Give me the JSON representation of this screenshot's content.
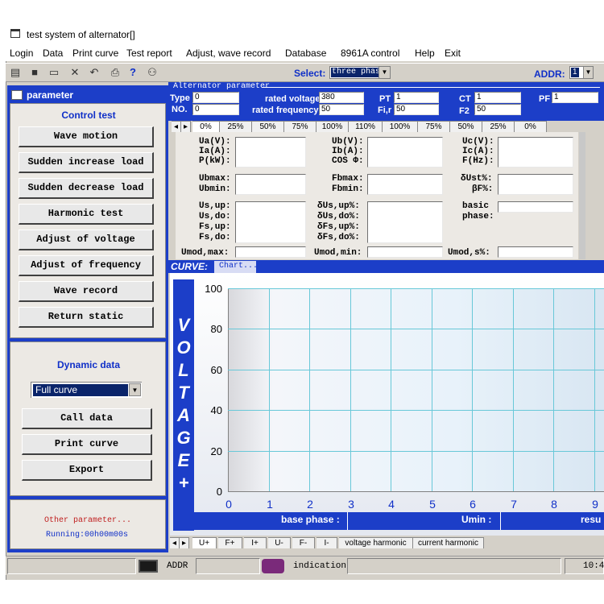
{
  "window": {
    "title": "test system of alternator[]"
  },
  "menu": [
    "Login",
    "Data",
    "Print curve",
    "Test report",
    "Adjust, wave record",
    "Database",
    "8961A control",
    "Help",
    "Exit"
  ],
  "toolbar": {
    "select_label": "Select:",
    "select_value": "three phase",
    "addr_label": "ADDR:",
    "addr_value": "1"
  },
  "left_panel": {
    "header": "parameter",
    "control_test_title": "Control test",
    "control_buttons": [
      "Wave motion",
      "Sudden increase load",
      "Sudden decrease load",
      "Harmonic test",
      "Adjust of voltage",
      "Adjust of frequency",
      "Wave record",
      "Return static"
    ],
    "dynamic_title": "Dynamic data",
    "curve_select": "Full curve",
    "dynamic_buttons": [
      "Call data",
      "Print curve",
      "Export"
    ],
    "other_param": "Other parameter...",
    "running": "Running:00h00m00s"
  },
  "alternator": {
    "title": "Alternator parameter",
    "type_label": "Type",
    "type_value": "0",
    "no_label": "NO.",
    "no_value": "0",
    "rated_voltage_label": "rated voltage",
    "rated_voltage_value": "380",
    "rated_freq_label": "rated frequency",
    "rated_freq_value": "50",
    "pt_label": "PT",
    "pt_value": "1",
    "fir_label": "Fi,r",
    "fir_value": "50",
    "ct_label": "CT",
    "ct_value": "1",
    "f2_label": "F2",
    "f2_value": "50",
    "pf_label": "PF",
    "pf_value": "1"
  },
  "load_tabs": [
    "0%",
    "25%",
    "50%",
    "75%",
    "100%",
    "110%",
    "100%",
    "75%",
    "50%",
    "25%",
    "0%"
  ],
  "measure": {
    "col1": [
      "Ua(V):",
      "Ia(A):",
      "P(kW):",
      "Ubmax:",
      "Ubmin:",
      "Us,up:",
      "Us,do:",
      "Fs,up:",
      "Fs,do:",
      "Umod,max:"
    ],
    "col2": [
      "Ub(V):",
      "Ib(A):",
      "COS Φ:",
      "Fbmax:",
      "Fbmin:",
      "δUs,up%:",
      "δUs,do%:",
      "δFs,up%:",
      "δFs,do%:",
      "Umod,min:"
    ],
    "col3": [
      "Uc(V):",
      "Ic(A):",
      "F(Hz):",
      "δUst%:",
      "βF%:",
      "basic",
      "phase:",
      "Umod,s%:"
    ]
  },
  "curve": {
    "label": "CURVE:",
    "chart_tab": "Chart...",
    "voltage_letters": [
      "V",
      "O",
      "L",
      "T",
      "A",
      "G",
      "E",
      "+"
    ],
    "y_ticks": [
      "100",
      "80",
      "60",
      "40",
      "20",
      "0"
    ],
    "x_ticks": [
      "0",
      "1",
      "2",
      "3",
      "4",
      "5",
      "6",
      "7",
      "8",
      "9"
    ],
    "base_phase": "base phase :",
    "umin": "Umin :",
    "resu": "resu"
  },
  "bottom_tabs": [
    "U+",
    "F+",
    "I+",
    "U-",
    "F-",
    "I-",
    "voltage harmonic",
    "current harmonic"
  ],
  "status": {
    "addr": "ADDR",
    "indication": "indication",
    "time": "10:4"
  },
  "colors": {
    "panel_blue": "#1c3ec8",
    "grid": "#68c8d8"
  }
}
